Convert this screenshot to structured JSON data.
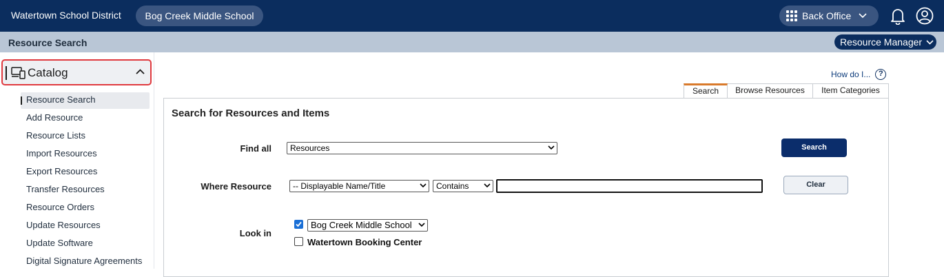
{
  "header": {
    "district": "Watertown School District",
    "school": "Bog Creek Middle School",
    "app_switcher": "Back Office"
  },
  "subheader": {
    "title": "Resource Search",
    "manager_menu": "Resource Manager"
  },
  "sidebar": {
    "section": "Catalog",
    "items": [
      {
        "label": "Resource Search"
      },
      {
        "label": "Add Resource"
      },
      {
        "label": "Resource Lists"
      },
      {
        "label": "Import Resources"
      },
      {
        "label": "Export Resources"
      },
      {
        "label": "Transfer Resources"
      },
      {
        "label": "Resource Orders"
      },
      {
        "label": "Update Resources"
      },
      {
        "label": "Update Software"
      },
      {
        "label": "Digital Signature Agreements"
      }
    ]
  },
  "help": {
    "label": "How do I..."
  },
  "tabs": [
    {
      "label": "Search"
    },
    {
      "label": "Browse Resources"
    },
    {
      "label": "Item Categories"
    }
  ],
  "form": {
    "title": "Search for Resources and Items",
    "find_all_label": "Find all",
    "find_all_value": "Resources",
    "where_label": "Where Resource",
    "field_value": "-- Displayable Name/Title",
    "operator_value": "Contains",
    "query_value": "",
    "look_in_label": "Look in",
    "look_in_school": "Bog Creek Middle School",
    "look_in_booking": "Watertown Booking Center",
    "search_button": "Search",
    "clear_button": "Clear"
  },
  "colors": {
    "brand_navy": "#0b2d5e",
    "highlight_red": "#e0393e",
    "tab_accent": "#d97a2b",
    "checkbox_blue": "#1a6fd6"
  }
}
